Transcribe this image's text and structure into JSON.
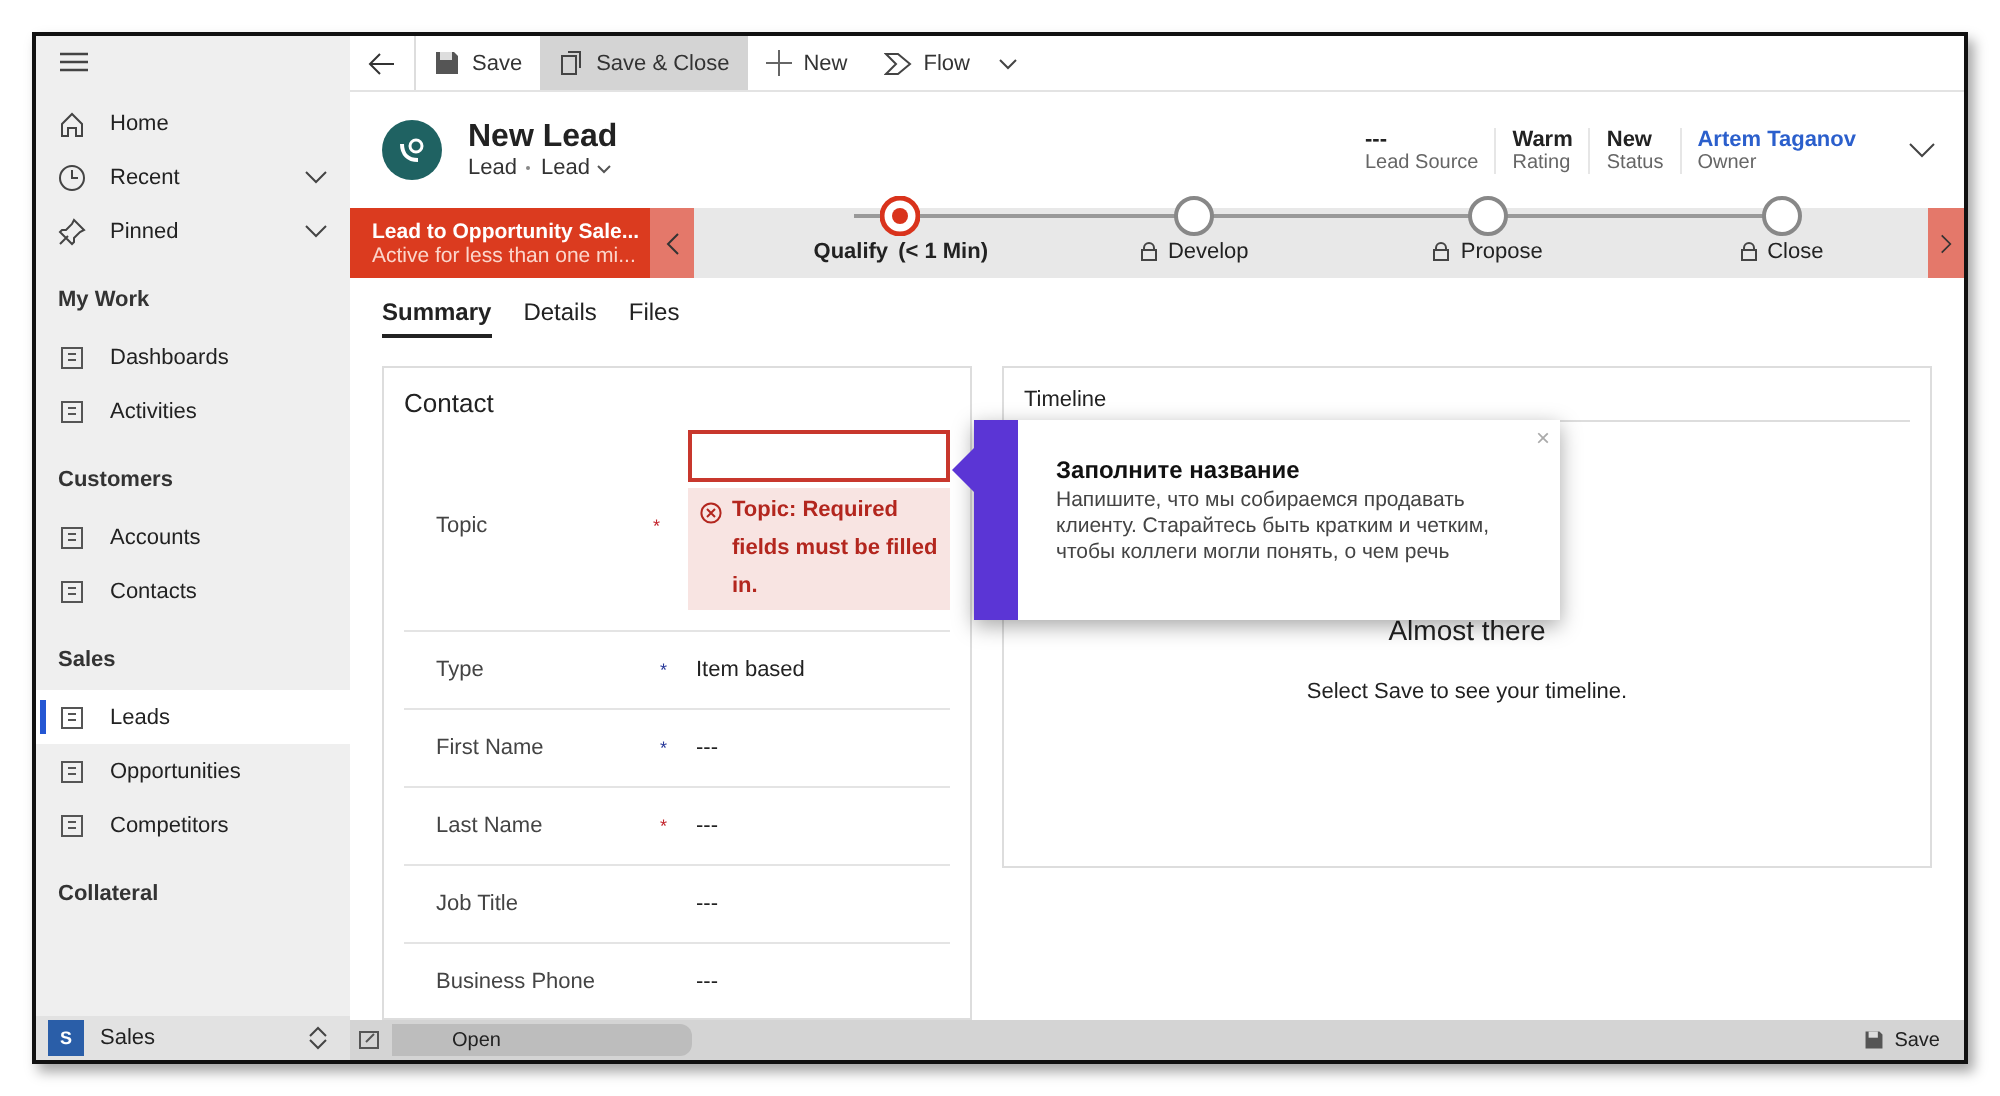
{
  "sidebar": {
    "top_items": [
      {
        "label": "Home",
        "expandable": false
      },
      {
        "label": "Recent",
        "expandable": true
      },
      {
        "label": "Pinned",
        "expandable": true
      }
    ],
    "groups": [
      {
        "title": "My Work",
        "items": [
          {
            "label": "Dashboards",
            "selected": false
          },
          {
            "label": "Activities",
            "selected": false
          }
        ]
      },
      {
        "title": "Customers",
        "items": [
          {
            "label": "Accounts",
            "selected": false
          },
          {
            "label": "Contacts",
            "selected": false
          }
        ]
      },
      {
        "title": "Sales",
        "items": [
          {
            "label": "Leads",
            "selected": true
          },
          {
            "label": "Opportunities",
            "selected": false
          },
          {
            "label": "Competitors",
            "selected": false
          }
        ]
      },
      {
        "title": "Collateral"
      }
    ],
    "app_switcher": {
      "badge": "S",
      "label": "Sales"
    }
  },
  "command_bar": [
    {
      "label": "Save",
      "highlighted": false
    },
    {
      "label": "Save & Close",
      "highlighted": true
    },
    {
      "label": "New",
      "highlighted": false
    },
    {
      "label": "Flow",
      "highlighted": false
    }
  ],
  "header": {
    "title": "New Lead",
    "entity": "Lead",
    "form": "Lead",
    "fields": [
      {
        "value": "---",
        "label": "Lead Source",
        "link": false
      },
      {
        "value": "Warm",
        "label": "Rating",
        "link": false
      },
      {
        "value": "New",
        "label": "Status",
        "link": false
      },
      {
        "value": "Artem Taganov",
        "label": "Owner",
        "link": true
      }
    ]
  },
  "process": {
    "name": "Lead to Opportunity Sale...",
    "subtitle": "Active for less than one mi...",
    "stages": [
      {
        "label": "Qualify",
        "duration": "(< 1 Min)",
        "active": true,
        "locked": false
      },
      {
        "label": "Develop",
        "active": false,
        "locked": true
      },
      {
        "label": "Propose",
        "active": false,
        "locked": true
      },
      {
        "label": "Close",
        "active": false,
        "locked": true
      }
    ]
  },
  "tabs": [
    {
      "label": "Summary",
      "selected": true
    },
    {
      "label": "Details",
      "selected": false
    },
    {
      "label": "Files",
      "selected": false
    }
  ],
  "contact": {
    "title": "Contact",
    "fields": [
      {
        "label": "Topic",
        "mark": "*",
        "required": true,
        "error": "Topic: Required fields must be filled in."
      },
      {
        "label": "Type",
        "mark": "*",
        "required": false,
        "value": "Item based"
      },
      {
        "label": "First Name",
        "mark": "*",
        "required": false,
        "value": "---"
      },
      {
        "label": "Last Name",
        "mark": "*",
        "required": true,
        "value": "---"
      },
      {
        "label": "Job Title",
        "value": "---"
      },
      {
        "label": "Business Phone",
        "value": "---"
      }
    ]
  },
  "timeline": {
    "title": "Timeline",
    "heading": "Almost there",
    "message": "Select Save to see your timeline."
  },
  "popup": {
    "title": "Заполните название",
    "body": "Напишите, что мы собираемся продавать клиенту. Старайтесь быть кратким и четким, чтобы коллеги могли понять, о чем речь",
    "close": "×"
  },
  "status_bar": {
    "left": "Open",
    "right": "Save"
  }
}
